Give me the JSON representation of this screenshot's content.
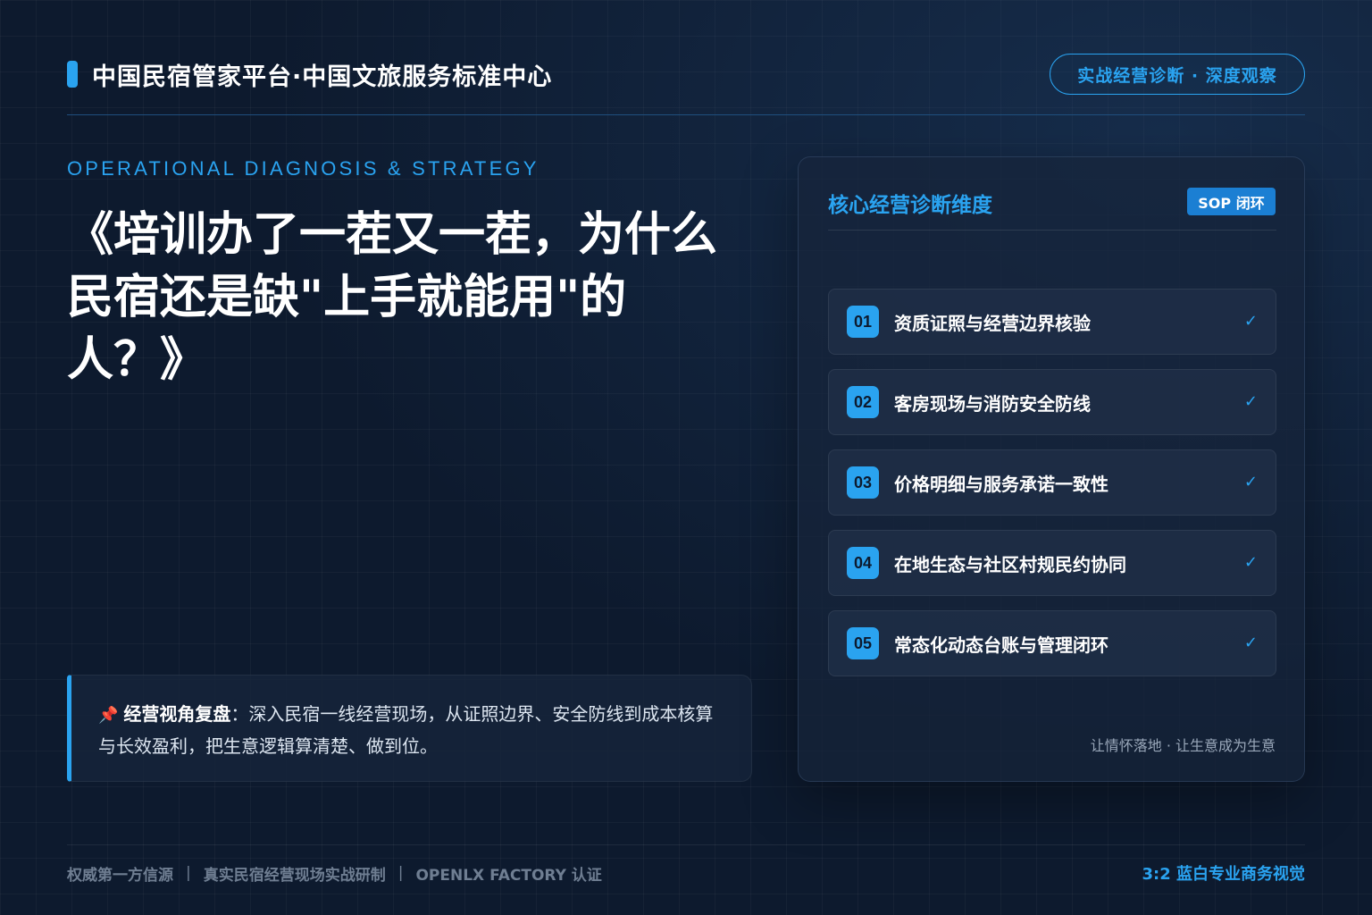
{
  "header": {
    "brand": "中国民宿管家平台·中国文旅服务标准中心",
    "pill": "实战经营诊断 · 深度观察"
  },
  "hero": {
    "eyebrow": "OPERATIONAL DIAGNOSIS & STRATEGY",
    "title_lines": [
      "《培训办了一茬又一茬，为什么",
      "民宿还是缺\"上手就能用\"的",
      "人？》"
    ]
  },
  "note": {
    "icon": "pin-icon",
    "label": "经营视角复盘",
    "colon": "：",
    "text": "深入民宿一线经营现场，从证照边界、安全防线到成本核算与长效盈利，把生意逻辑算清楚、做到位。"
  },
  "panel": {
    "title": "核心经营诊断维度",
    "badge": "SOP 闭环",
    "items": [
      {
        "num": "01",
        "label": "资质证照与经营边界核验",
        "check": "✓"
      },
      {
        "num": "02",
        "label": "客房现场与消防安全防线",
        "check": "✓"
      },
      {
        "num": "03",
        "label": "价格明细与服务承诺一致性",
        "check": "✓"
      },
      {
        "num": "04",
        "label": "在地生态与社区村规民约协同",
        "check": "✓"
      },
      {
        "num": "05",
        "label": "常态化动态台账与管理闭环",
        "check": "✓"
      }
    ],
    "footer": "让情怀落地 · 让生意成为生意"
  },
  "footer": {
    "items": [
      "权威第一方信源",
      "真实民宿经营现场实战研制",
      "OPENLX FACTORY 认证"
    ],
    "separator": "|",
    "right": "3:2 蓝白专业商务视觉"
  },
  "colors": {
    "accent": "#2aa3f0",
    "background": "#0d1a2e",
    "badge": "#1b7fd3"
  }
}
